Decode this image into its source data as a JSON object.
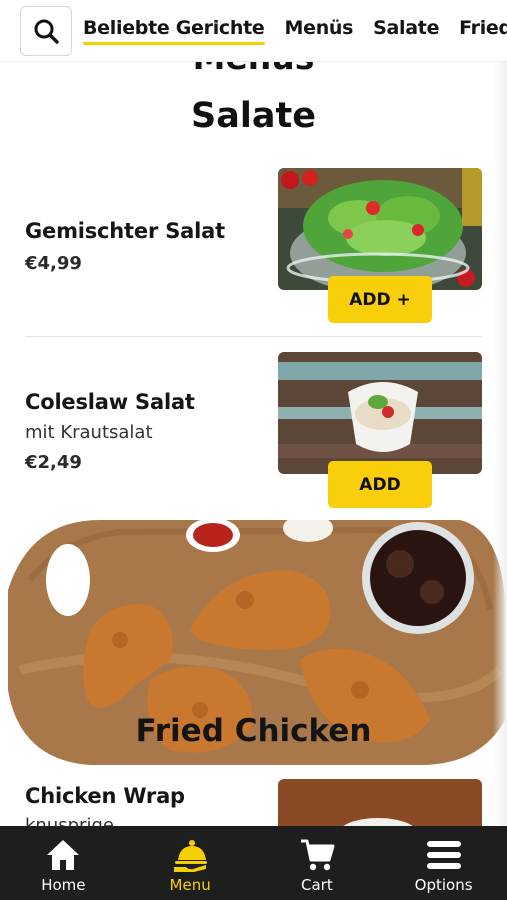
{
  "tabs": [
    {
      "label": "Beliebte Gerichte",
      "active": true
    },
    {
      "label": "Menüs",
      "active": false
    },
    {
      "label": "Salate",
      "active": false
    },
    {
      "label": "Fried Chicken",
      "active": false
    }
  ],
  "headings": {
    "previous_section": "Menüs",
    "current_section": "Salate"
  },
  "items": [
    {
      "name": "Gemischter Salat",
      "description": "",
      "price": "€4,99",
      "button": "ADD +"
    },
    {
      "name": "Coleslaw Salat",
      "description": "mit Krautsalat",
      "price": "€2,49",
      "button": "ADD"
    },
    {
      "name": "Chicken Wrap",
      "description": "knusprige",
      "price": "",
      "button": ""
    }
  ],
  "banner": {
    "title": "Fried Chicken"
  },
  "bottom_nav": [
    {
      "label": "Home",
      "icon": "home-icon",
      "active": false
    },
    {
      "label": "Menu",
      "icon": "menu-cloche-icon",
      "active": true
    },
    {
      "label": "Cart",
      "icon": "cart-icon",
      "active": false
    },
    {
      "label": "Options",
      "icon": "hamburger-icon",
      "active": false
    }
  ],
  "colors": {
    "accent": "#f9cf0c",
    "nav_bg": "#1e1e1e",
    "active_nav": "#f5d000"
  }
}
